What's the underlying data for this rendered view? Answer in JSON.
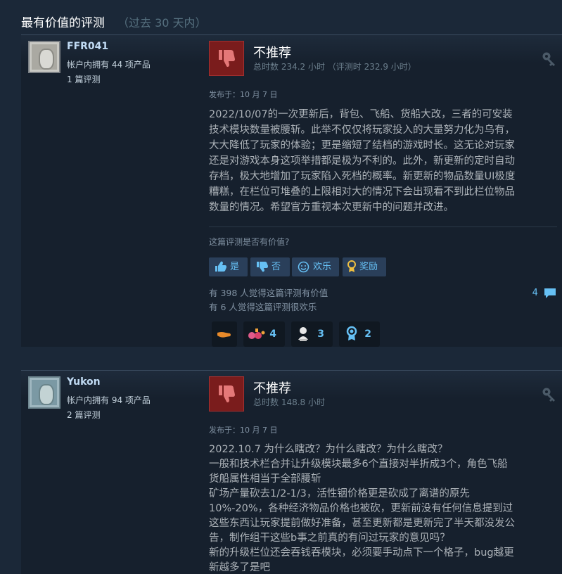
{
  "header": {
    "title": "最有价值的评测",
    "subtitle": "（过去 30 天内）"
  },
  "reviews": [
    {
      "author": "FFR041",
      "products": "帐户内拥有 44 项产品",
      "review_count": "1 篇评测",
      "verdict": "不推荐",
      "hours": "总时数 234.2 小时 （评测时 232.9 小时）",
      "posted": "发布于：10 月 7 日",
      "text": "2022/10/07的一次更新后，背包、飞船、货船大改，三者的可安装\n技术模块数量被腰斩。此举不仅仅将玩家投入的大量努力化为乌有，\n大大降低了玩家的体验；更是缩短了结档的游戏时长。这无论对玩家\n还是对游戏本身这项举措都是极为不利的。此外，新更新的定时自动\n存档，极大地增加了玩家陷入死档的概率。新更新的物品数量UI极度\n糟糕，在栏位可堆叠的上限相对大的情况下会出现看不到此栏位物品\n数量的情况。希望官方重视本次更新中的问题并改进。",
      "helpful_question": "这篇评测是否有价值?",
      "buttons": {
        "yes": "是",
        "no": "否",
        "funny": "欢乐",
        "award": "奖励"
      },
      "helpful_stat": "有 398 人觉得这篇评测有价值",
      "funny_stat": "有 6 人觉得这篇评测很欢乐",
      "comment_count": "4",
      "awards": [
        "",
        "4",
        "3",
        "2"
      ]
    },
    {
      "author": "Yukon",
      "products": "帐户内拥有 94 项产品",
      "review_count": "2 篇评测",
      "verdict": "不推荐",
      "hours": "总时数 148.8 小时",
      "posted": "发布于：10 月 7 日",
      "text": "2022.10.7 为什么瞎改？为什么瞎改？为什么瞎改？\n一般和技术栏合并让升级模块最多6个直接对半折成3个，角色飞船\n货船属性相当于全部腰斩\n矿场产量砍去1/2-1/3，活性铟价格更是砍成了离谱的原先\n10%-20%，各种经济物品价格也被砍，更新前没有任何信息提到过\n这些东西让玩家提前做好准备，甚至更新都是更新完了半天都没发公\n告，制作组干这些b事之前真的有问过玩家的意见吗？\n新的升级栏位还会吞钱吞模块，必须要手动点下一个格子，bug越更\n新越多了是吧"
    }
  ],
  "colors": {
    "accent": "#66c0f4",
    "thumb_bg": "#7a1c1c",
    "background": "#1b2838"
  },
  "icons": [
    "thumb-down-icon",
    "key-icon",
    "thumb-up-icon",
    "smiley-icon",
    "award-ribbon-icon",
    "comment-bubble-icon"
  ]
}
